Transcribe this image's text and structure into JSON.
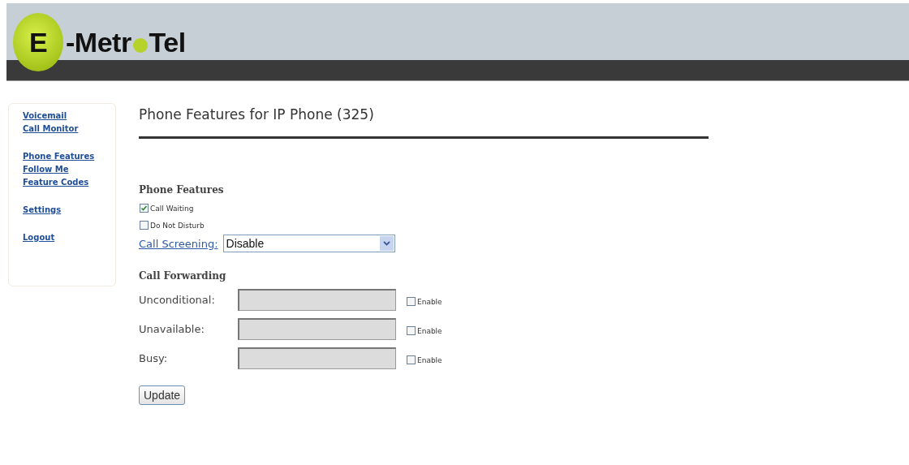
{
  "logo": {
    "initial": "E",
    "name_start": "-Metr",
    "name_end": "Tel"
  },
  "sidebar": {
    "groups": [
      {
        "items": [
          {
            "label": "Voicemail"
          },
          {
            "label": "Call Monitor"
          }
        ]
      },
      {
        "items": [
          {
            "label": "Phone Features"
          },
          {
            "label": "Follow Me"
          },
          {
            "label": "Feature Codes"
          }
        ]
      },
      {
        "items": [
          {
            "label": "Settings"
          }
        ]
      },
      {
        "items": [
          {
            "label": "Logout"
          }
        ]
      }
    ]
  },
  "page_title": "Phone Features for IP Phone (325)",
  "phone_features": {
    "heading": "Phone Features",
    "options": [
      {
        "label": "Call Waiting",
        "checked": true
      },
      {
        "label": "Do Not Disturb",
        "checked": false
      }
    ],
    "call_screening": {
      "label": "Call Screening:",
      "value": "Disable"
    }
  },
  "call_forwarding": {
    "heading": "Call Forwarding",
    "rows": [
      {
        "label": "Unconditional:",
        "disabled": true,
        "enable_label": "Enable",
        "checked": false
      },
      {
        "label": "Unavailable:",
        "disabled": true,
        "enable_label": "Enable",
        "checked": false
      },
      {
        "label": "Busy:",
        "disabled": true,
        "enable_label": "Enable",
        "checked": false
      }
    ]
  },
  "update_button": "Update"
}
